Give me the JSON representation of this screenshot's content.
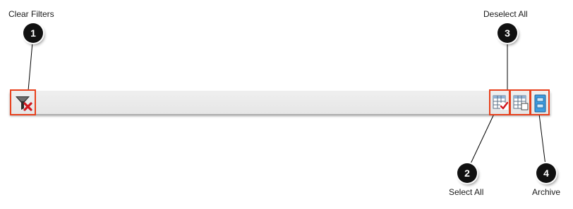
{
  "callouts": [
    {
      "number": "1",
      "label": "Clear Filters"
    },
    {
      "number": "2",
      "label": "Select All"
    },
    {
      "number": "3",
      "label": "Deselect All"
    },
    {
      "number": "4",
      "label": "Archive"
    }
  ],
  "toolbar": {
    "icons": [
      "filter-clear-icon",
      "select-all-icon",
      "deselect-all-icon",
      "archive-icon"
    ]
  },
  "colors": {
    "highlight": "#e8401c",
    "badge": "#111111",
    "toolbar": "#ebebeb",
    "archive": "#3d9be0"
  }
}
